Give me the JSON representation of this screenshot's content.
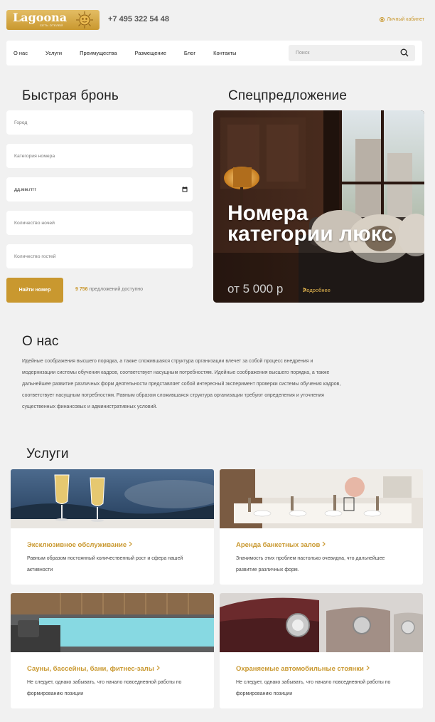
{
  "header": {
    "logo_text": "Lagoona",
    "logo_sub": "сеть отелей",
    "phone": "+7 495 322 54 48",
    "cabinet_label": "Личный кабинет"
  },
  "nav": {
    "items": [
      "О нас",
      "Услуги",
      "Преимущества",
      "Размещение",
      "Блог",
      "Контакты"
    ],
    "search_placeholder": "Поиск"
  },
  "booking": {
    "title": "Быстрая бронь",
    "city_placeholder": "Город",
    "category_placeholder": "Категория номера",
    "date_value": "дд.мм.гггг",
    "nights_placeholder": "Количество ночей",
    "guests_placeholder": "Количество гостей",
    "submit_label": "Найти номер",
    "offers_count": "9 756",
    "offers_text": "предложений доступно"
  },
  "special": {
    "title": "Спецпредложение",
    "headline": "Номера категории люкс",
    "price": "от 5 000 р",
    "more_label": "Подробнее"
  },
  "about": {
    "title": "О нас",
    "text": "Идейные соображения высшего порядка, а также сложившаяся структура организации влечет за собой процесс внедрения и модернизации системы обучения кадров, соответствует насущным потребностям. Идейные соображения высшего порядка, а также дальнейшее развитие различных форм деятельности представляет собой интересный эксперимент проверки системы обучения кадров, соответствует насущным потребностям. Равным образом сложившаяся структура организации требуют определения и уточнения существенных финансовых и административных условий."
  },
  "services": {
    "title": "Услуги",
    "cards": [
      {
        "title": "Эксклюзивное обслуживание",
        "desc": "Равным образом постоянный количественный рост и сфера нашей активности"
      },
      {
        "title": "Аренда банкетных залов",
        "desc": "Значимость этих проблем настолько очевидна, что дальнейшее развитие различных форм."
      },
      {
        "title": "Сауны, бассейны, бани, фитнес-залы",
        "desc": "Не следует, однако забывать, что начало повседневной работы по формированию позиции"
      },
      {
        "title": "Охраняемые автомобильные стоянки",
        "desc": "Не следует, однако забывать, что начало повседневной работы по формированию позиции"
      }
    ]
  },
  "colors": {
    "accent": "#c9982f",
    "background": "#f1f1f1"
  }
}
